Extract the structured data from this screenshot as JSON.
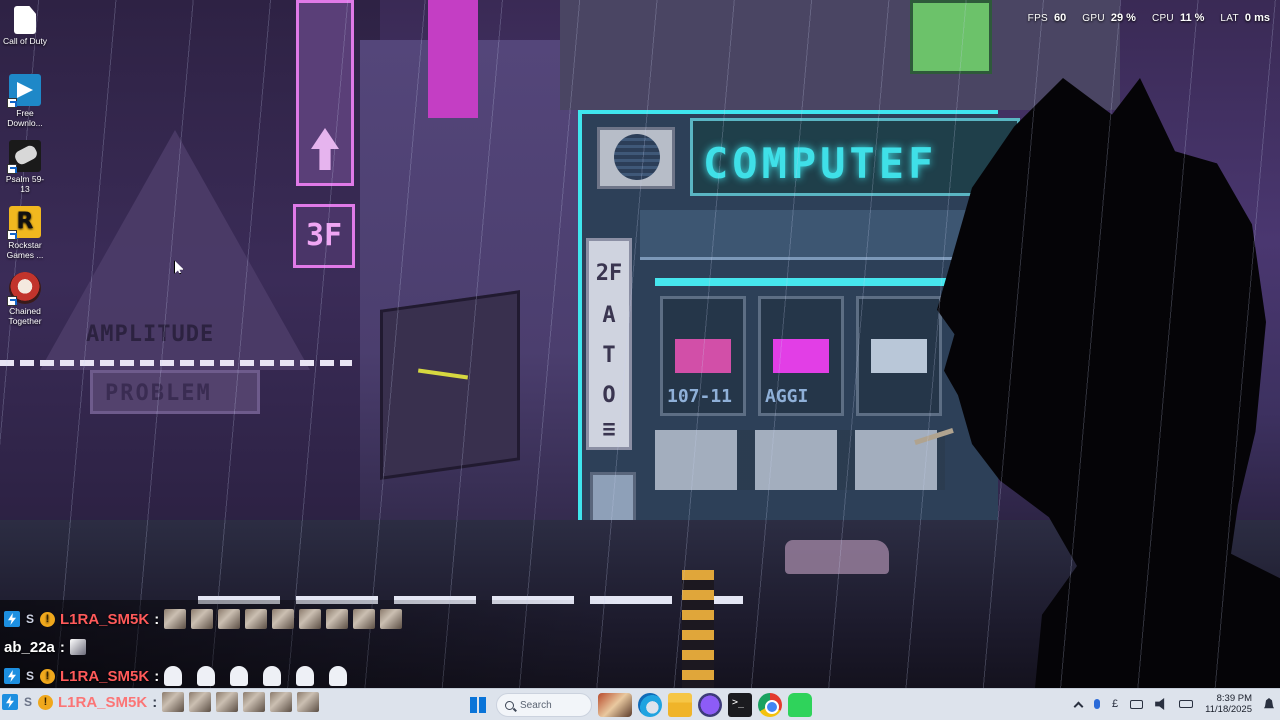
{
  "hud": {
    "fps_label": "FPS",
    "fps_value": "60",
    "gpu_label": "GPU",
    "gpu_value": "29 %",
    "cpu_label": "CPU",
    "cpu_value": "11 %",
    "lat_label": "LAT",
    "lat_value": "0 ms"
  },
  "wallpaper": {
    "shop_sign_text": "COMPUTEF",
    "floor_sign": "3F",
    "panel_chars": [
      "2F",
      "A",
      "T",
      "O",
      "≡"
    ],
    "amplitude_text": "AMPLITUDE",
    "problem_text": "PROBLEM",
    "booth_labels": [
      "107-11",
      "AGGI"
    ]
  },
  "desktop_icons": [
    {
      "label": "Call of Duty",
      "icon": "document-icon"
    },
    {
      "label": "Free Downlo...",
      "icon": "free-download-icon"
    },
    {
      "label": "Psalm 59-13",
      "icon": "psalm-icon"
    },
    {
      "label": "Rockstar Games ...",
      "icon": "rockstar-icon"
    },
    {
      "label": "Chained Together",
      "icon": "chained-together-icon"
    }
  ],
  "chat": {
    "lines": [
      {
        "user": "L1RA_SM5K",
        "separator": ":"
      },
      {
        "user": "ab_22a",
        "separator": ":"
      },
      {
        "user": "L1RA_SM5K",
        "separator": ":"
      },
      {
        "user": "L1RA_SM5K",
        "separator": ":"
      }
    ],
    "badge_s": "S",
    "badge_warn": "!"
  },
  "taskbar": {
    "search_placeholder": "Search",
    "clock_time": "8:39 PM",
    "clock_date": "11/18/2025",
    "tray_currency": "£"
  },
  "colors": {
    "accent_cyan": "#3fe6ee",
    "username_red": "#ff5a5a",
    "taskbar_bg": "#dde3ec"
  }
}
